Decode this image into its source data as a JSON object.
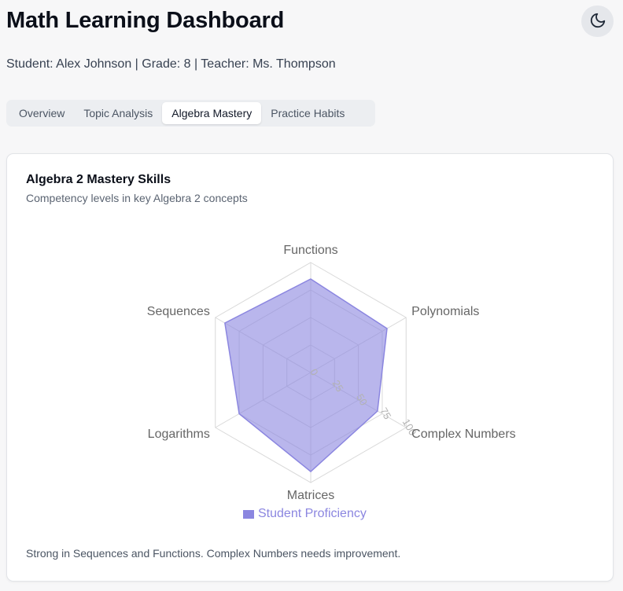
{
  "header": {
    "title": "Math Learning Dashboard",
    "theme_icon": "moon-icon"
  },
  "student_info": "Student: Alex Johnson | Grade: 8 | Teacher: Ms. Thompson",
  "tabs": [
    {
      "label": "Overview",
      "active": false
    },
    {
      "label": "Topic Analysis",
      "active": false
    },
    {
      "label": "Algebra Mastery",
      "active": true
    },
    {
      "label": "Practice Habits",
      "active": false
    }
  ],
  "card": {
    "title": "Algebra 2 Mastery Skills",
    "subtitle": "Competency levels in key Algebra 2 concepts",
    "insight": "Strong in Sequences and Functions. Complex Numbers needs improvement."
  },
  "colors": {
    "series_fill": "#8b86e0",
    "grid": "#d9d9d9",
    "axis_label": "#666666"
  },
  "chart_data": {
    "type": "radar",
    "categories": [
      "Functions",
      "Polynomials",
      "Complex Numbers",
      "Matrices",
      "Logarithms",
      "Sequences"
    ],
    "series": [
      {
        "name": "Student Proficiency",
        "values": [
          85,
          80,
          70,
          90,
          75,
          90
        ]
      }
    ],
    "rlim": [
      0,
      100
    ],
    "ticks": [
      "0",
      "25",
      "50",
      "75",
      "100"
    ],
    "legend": "bottom"
  }
}
